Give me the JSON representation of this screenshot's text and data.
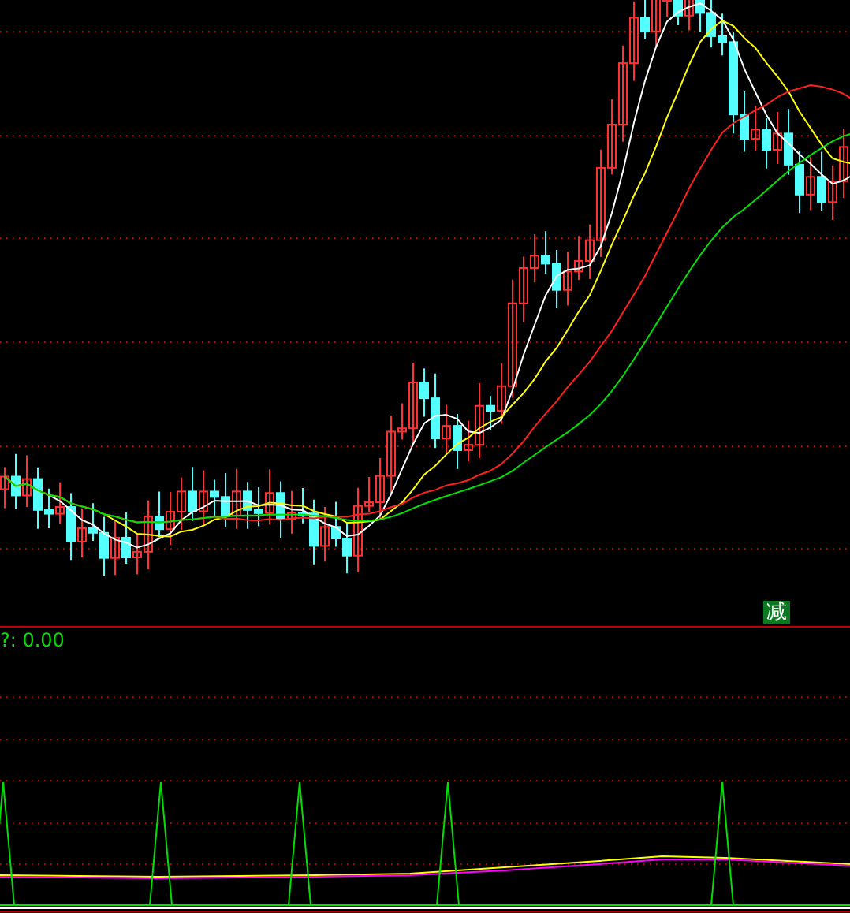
{
  "price_chart": {
    "signal_badge": {
      "label": "减"
    }
  },
  "indicator_panel": {
    "reading": "?: 0.00"
  }
}
